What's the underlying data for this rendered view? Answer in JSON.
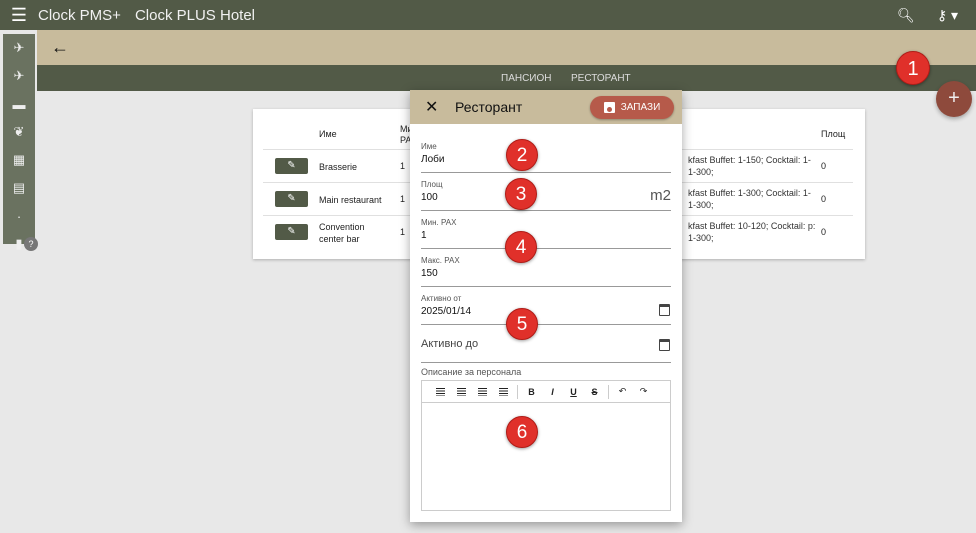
{
  "topbar": {
    "app_name": "Clock PMS+",
    "hotel_name": "Clock PLUS Hotel"
  },
  "tabs": [
    {
      "label": "ПАНСИОН"
    },
    {
      "label": "РЕСТОРАНТ"
    }
  ],
  "fab": {
    "label": "+"
  },
  "help": {
    "label": "?"
  },
  "table": {
    "headers": {
      "name": "Име",
      "min_pax": "Ми\nPA",
      "area": "Площ"
    },
    "rows": [
      {
        "name": "Brasserie",
        "min": "1",
        "desc": "kfast Buffet: 1-150; Cocktail: 1-1-300;",
        "area": "0"
      },
      {
        "name": "Main restaurant",
        "min": "1",
        "desc": "kfast Buffet: 1-300; Cocktail: 1-1-300;",
        "area": "0"
      },
      {
        "name": "Convention center bar",
        "min": "1",
        "desc": "kfast Buffet: 10-120; Cocktail: p: 1-300;",
        "area": "0"
      }
    ]
  },
  "dialog": {
    "title": "Ресторант",
    "save_label": "ЗАПАЗИ",
    "fields": {
      "name": {
        "label": "Име",
        "value": "Лоби"
      },
      "area": {
        "label": "Площ",
        "value": "100",
        "unit": "m2"
      },
      "min_pax": {
        "label": "Мин. PAX",
        "value": "1"
      },
      "max_pax": {
        "label": "Макс. PAX",
        "value": "150"
      },
      "active_from": {
        "label": "Активно от",
        "value": "2025/01/14"
      },
      "active_to": {
        "placeholder": "Активно до"
      }
    },
    "staff_desc_label": "Описание за персонала"
  },
  "callouts": [
    "1",
    "2",
    "3",
    "4",
    "5",
    "6"
  ],
  "colors": {
    "primary": "#525a47",
    "accent": "#c8bb9c",
    "save": "#b65a4a",
    "callout": "#e0302a"
  }
}
